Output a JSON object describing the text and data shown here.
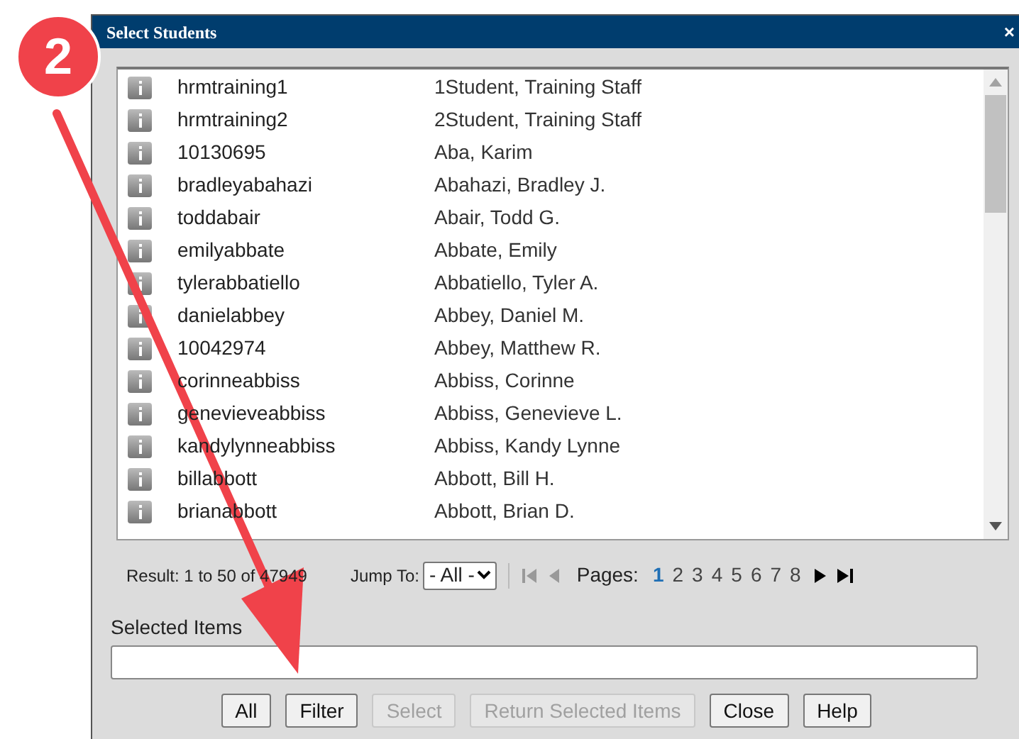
{
  "annotation": {
    "badge": "2"
  },
  "dialog": {
    "title": "Select Students",
    "close": "×"
  },
  "students": [
    {
      "username": "hrmtraining1",
      "name": "1Student, Training Staff"
    },
    {
      "username": "hrmtraining2",
      "name": "2Student, Training Staff"
    },
    {
      "username": "10130695",
      "name": "Aba, Karim"
    },
    {
      "username": "bradleyabahazi",
      "name": "Abahazi, Bradley J."
    },
    {
      "username": "toddabair",
      "name": "Abair, Todd G."
    },
    {
      "username": "emilyabbate",
      "name": "Abbate, Emily"
    },
    {
      "username": "tylerabbatiello",
      "name": "Abbatiello, Tyler A."
    },
    {
      "username": "danielabbey",
      "name": "Abbey, Daniel M."
    },
    {
      "username": "10042974",
      "name": "Abbey, Matthew R."
    },
    {
      "username": "corinneabbiss",
      "name": "Abbiss, Corinne"
    },
    {
      "username": "genevieveabbiss",
      "name": "Abbiss, Genevieve L."
    },
    {
      "username": "kandylynneabbiss",
      "name": "Abbiss, Kandy Lynne"
    },
    {
      "username": "billabbott",
      "name": "Abbott, Bill H."
    },
    {
      "username": "brianabbott",
      "name": "Abbott, Brian D."
    }
  ],
  "pager": {
    "result": "Result: 1 to 50 of 47949",
    "jump_label": "Jump To:",
    "jump_value": "- All -",
    "pages_label": "Pages:",
    "pages": [
      {
        "label": "1",
        "selected": true
      },
      {
        "label": "2",
        "selected": false
      },
      {
        "label": "3",
        "selected": false
      },
      {
        "label": "4",
        "selected": false
      },
      {
        "label": "5",
        "selected": false
      },
      {
        "label": "6",
        "selected": false
      },
      {
        "label": "7",
        "selected": false
      },
      {
        "label": "8",
        "selected": false
      }
    ]
  },
  "selected_items": {
    "label": "Selected Items"
  },
  "buttons": [
    {
      "label": "All",
      "disabled": false
    },
    {
      "label": "Filter",
      "disabled": false
    },
    {
      "label": "Select",
      "disabled": true
    },
    {
      "label": "Return Selected Items",
      "disabled": true
    },
    {
      "label": "Close",
      "disabled": false
    },
    {
      "label": "Help",
      "disabled": false
    }
  ]
}
